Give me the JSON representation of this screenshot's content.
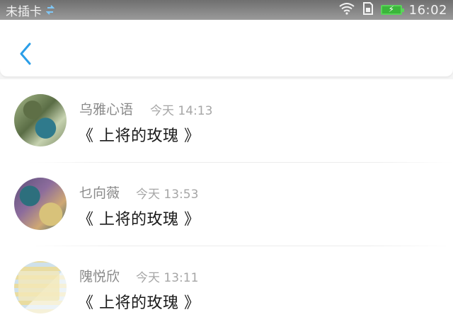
{
  "status_bar": {
    "carrier": "未插卡",
    "time": "16:02",
    "icons": [
      "sim-swap-icon",
      "wifi-icon",
      "sim-card-icon",
      "battery-charging-icon"
    ]
  },
  "header": {
    "back_icon": "chevron-left-icon",
    "accent_color": "#2a9ee8"
  },
  "messages": [
    {
      "name": "乌雅心语",
      "time": "今天 14:13",
      "text": "《 上将的玫瑰 》"
    },
    {
      "name": "乜向薇",
      "time": "今天 13:53",
      "text": "《 上将的玫瑰 》"
    },
    {
      "name": "隗悦欣",
      "time": "今天 13:11",
      "text": "《 上将的玫瑰 》"
    }
  ]
}
